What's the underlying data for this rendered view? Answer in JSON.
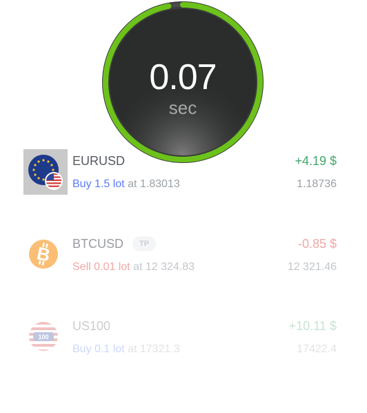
{
  "timer": {
    "value": "0.07",
    "unit": "sec",
    "progress": 0.97,
    "ring_color": "#6cc21a"
  },
  "trades": [
    {
      "symbol": "EURUSD",
      "icon": "eu-us-flags-icon",
      "side": "Buy",
      "lot": "1.5 lot",
      "at_label": "at",
      "open_price": "1.83013",
      "pnl": "+4.19 $",
      "current_price": "1.18736"
    },
    {
      "symbol": "BTCUSD",
      "icon": "bitcoin-icon",
      "badge": "TP",
      "side": "Sell",
      "lot": "0.01 lot",
      "at_label": "at",
      "open_price": "12 324.83",
      "pnl": "-0.85 $",
      "current_price": "12 321.46"
    },
    {
      "symbol": "US100",
      "icon": "us-flag-100-icon",
      "icon_label": "100",
      "side": "Buy",
      "lot": "0.1 lot",
      "at_label": "at",
      "open_price": "17321.3",
      "pnl": "+10.11 $",
      "current_price": "17422.4"
    }
  ],
  "colors": {
    "buy": "#5b7cf6",
    "sell": "#e86a6a",
    "profit": "#43a66c",
    "loss": "#e86a6a",
    "timer_bg": "#2b2c2c"
  }
}
